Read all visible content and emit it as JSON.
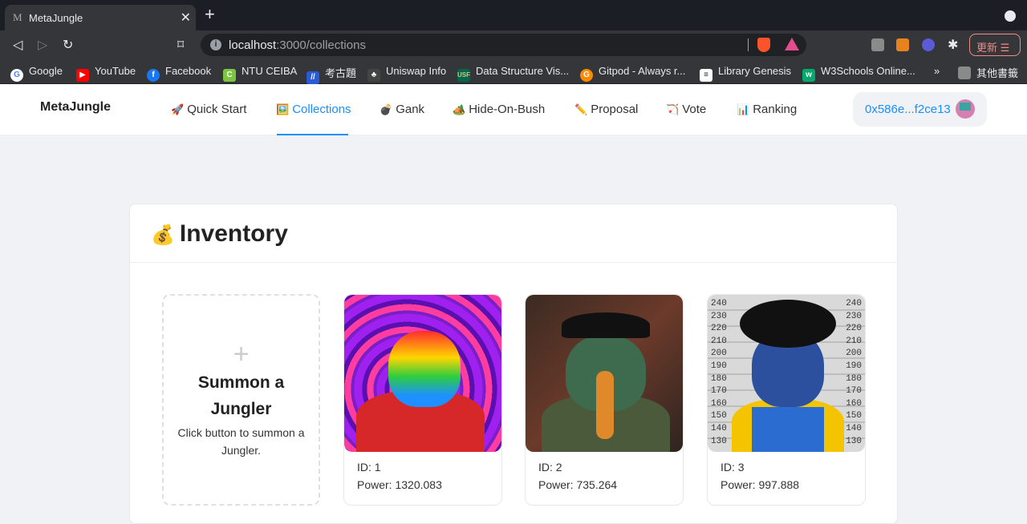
{
  "browser": {
    "tab_title": "MetaJungle",
    "tab_favicon": "M",
    "url_host": "localhost",
    "url_path": ":3000/collections",
    "update_label": "更新 ☰",
    "bookmarks": [
      {
        "label": "Google",
        "icon": "google-icon"
      },
      {
        "label": "YouTube",
        "icon": "youtube-icon"
      },
      {
        "label": "Facebook",
        "icon": "facebook-icon"
      },
      {
        "label": "NTU CEIBA",
        "icon": "ceiba-icon"
      },
      {
        "label": "考古題",
        "icon": "bookmark-icon"
      },
      {
        "label": "Uniswap Info",
        "icon": "uniswap-icon"
      },
      {
        "label": "Data Structure Vis...",
        "icon": "usf-icon"
      },
      {
        "label": "Gitpod - Always r...",
        "icon": "gitpod-icon"
      },
      {
        "label": "Library Genesis",
        "icon": "library-icon"
      },
      {
        "label": "W3Schools Online...",
        "icon": "w3schools-icon"
      },
      {
        "label": "»",
        "icon": ""
      },
      {
        "label": "其他書籤",
        "icon": "folder-icon"
      }
    ]
  },
  "header": {
    "logo": "MetaJungle",
    "menu": [
      {
        "emoji": "🚀",
        "label": "Quick Start"
      },
      {
        "emoji": "🖼️",
        "label": "Collections"
      },
      {
        "emoji": "💣",
        "label": "Gank"
      },
      {
        "emoji": "🏕️",
        "label": "Hide-On-Bush"
      },
      {
        "emoji": "✏️",
        "label": "Proposal"
      },
      {
        "emoji": "🏹",
        "label": "Vote"
      },
      {
        "emoji": "📊",
        "label": "Ranking"
      }
    ],
    "active_menu": "Collections",
    "wallet_address": "0x586e...f2ce13"
  },
  "inventory": {
    "icon": "💰",
    "title": "Inventory",
    "summon": {
      "plus": "+",
      "title": "Summon a Jungler",
      "description": "Click button to summon a Jungler."
    },
    "items": [
      {
        "id": "ID: 1",
        "power": "Power: 1320.083"
      },
      {
        "id": "ID: 2",
        "power": "Power: 735.264"
      },
      {
        "id": "ID: 3",
        "power": "Power: 997.888"
      }
    ]
  },
  "colors": {
    "accent": "#1890ff",
    "background": "#f0f2f5"
  }
}
